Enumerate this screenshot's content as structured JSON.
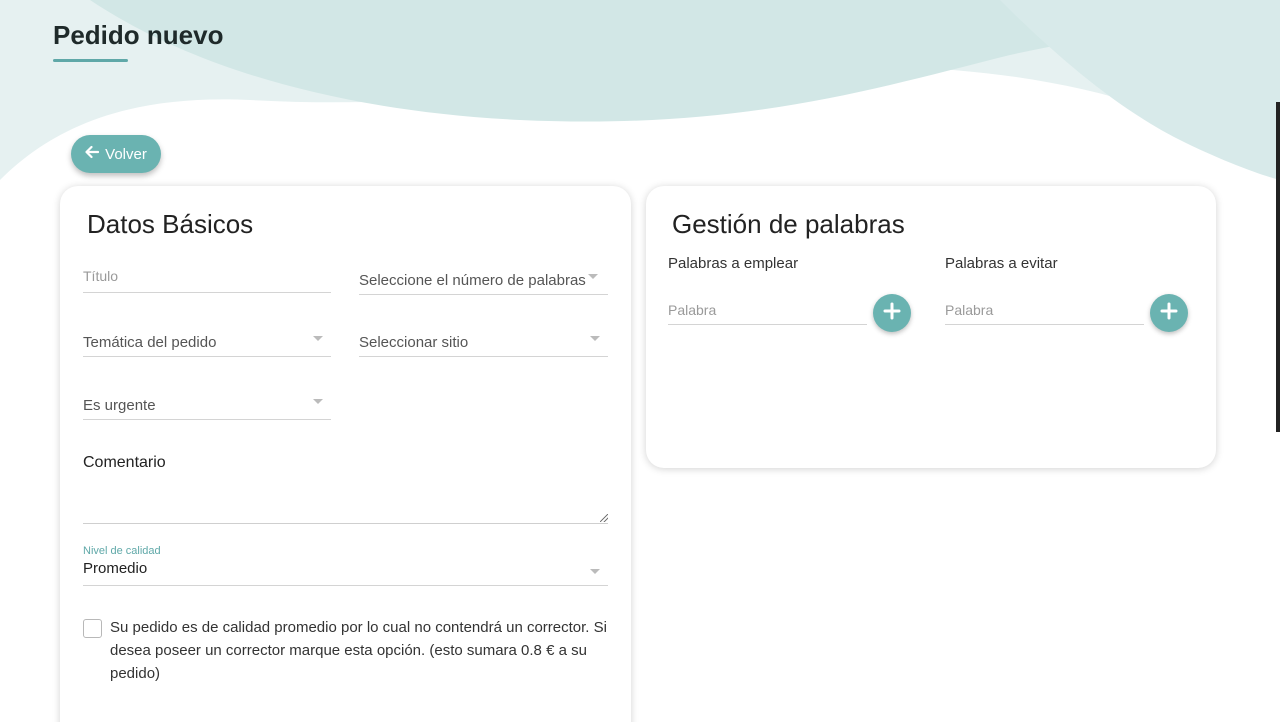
{
  "header": {
    "title": "Pedido nuevo",
    "back_label": "Volver"
  },
  "basic": {
    "title": "Datos Básicos",
    "titulo_placeholder": "Título",
    "num_palabras_placeholder": "Seleccione el número de palabras",
    "tematica_placeholder": "Temática del pedido",
    "sitio_placeholder": "Seleccionar sitio",
    "urgente_placeholder": "Es urgente",
    "comentario_placeholder": "Comentario",
    "calidad_label": "Nivel de calidad",
    "calidad_value": "Promedio",
    "corrector_checked": false,
    "corrector_text": "Su pedido es de calidad promedio por lo cual no contendrá un corrector. Si desea poseer un corrector marque esta opción. (esto sumara 0.8 € a su pedido)"
  },
  "words": {
    "title": "Gestión de palabras",
    "use_label": "Palabras a emplear",
    "use_placeholder": "Palabra",
    "avoid_label": "Palabras a evitar",
    "avoid_placeholder": "Palabra"
  },
  "colors": {
    "accent": "#6ab3b1",
    "wave": "#e6f1f1"
  }
}
